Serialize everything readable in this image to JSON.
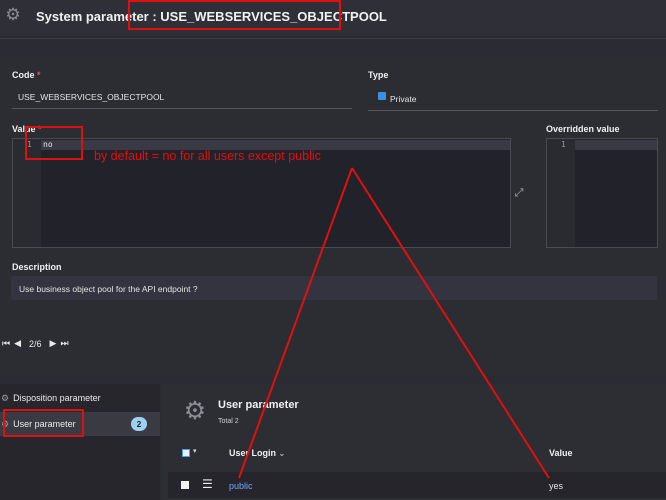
{
  "header": {
    "title_prefix": "System parameter : ",
    "title_value": "USE_WEBSERVICES_OBJECTPOOL"
  },
  "form": {
    "code_label": "Code",
    "required_mark": "*",
    "code_value": "USE_WEBSERVICES_OBJECTPOOL",
    "type_label": "Type",
    "type_value": "Private",
    "value_label": "Value",
    "value_line": "1",
    "value_text": "no",
    "overridden_label": "Overridden value",
    "overridden_line": "1",
    "description_label": "Description",
    "description_value": "Use business object pool for the API endpoint ?"
  },
  "pager": {
    "first": "⏮",
    "prev": "◀",
    "position": "2/6",
    "next": "▶",
    "last": "⏭"
  },
  "sidebar": {
    "items": [
      {
        "label": "Disposition parameter"
      },
      {
        "label": "User parameter",
        "count": "2"
      }
    ]
  },
  "user_param": {
    "title": "User parameter",
    "total": "Total 2",
    "columns": {
      "login": "User Login",
      "value": "Value"
    },
    "rows": [
      {
        "login": "public",
        "value": "yes"
      }
    ]
  },
  "annotation": {
    "text": "by default = no for all users except public",
    "color": "#e01010"
  },
  "icons": {
    "gear": "gear-icon",
    "expand": "expand-icon",
    "menu": "hamburger-icon"
  }
}
